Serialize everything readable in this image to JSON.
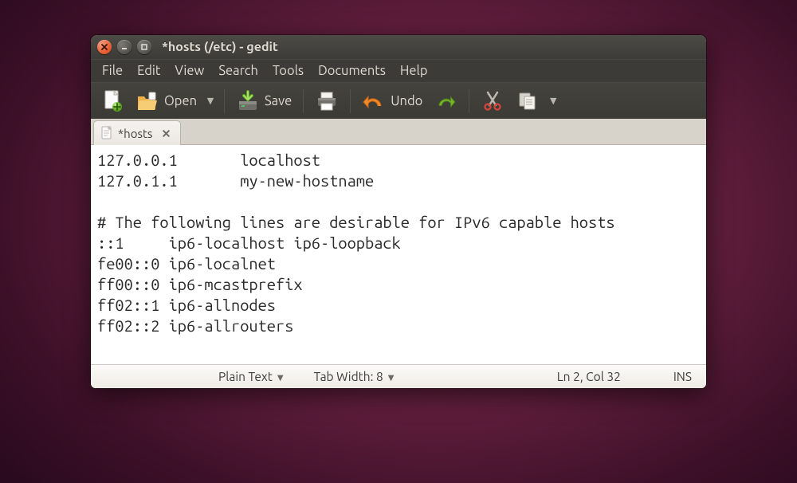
{
  "window": {
    "title": "*hosts (/etc) - gedit"
  },
  "menu": {
    "file": "File",
    "edit": "Edit",
    "view": "View",
    "search": "Search",
    "tools": "Tools",
    "documents": "Documents",
    "help": "Help"
  },
  "toolbar": {
    "open_label": "Open",
    "save_label": "Save",
    "undo_label": "Undo"
  },
  "tab": {
    "label": "*hosts"
  },
  "editor": {
    "content": "127.0.0.1       localhost\n127.0.1.1       my-new-hostname\n\n# The following lines are desirable for IPv6 capable hosts\n::1     ip6-localhost ip6-loopback\nfe00::0 ip6-localnet\nff00::0 ip6-mcastprefix\nff02::1 ip6-allnodes\nff02::2 ip6-allrouters"
  },
  "status": {
    "syntax": "Plain Text",
    "tabwidth": "Tab Width: 8",
    "position": "Ln 2, Col 32",
    "mode": "INS"
  }
}
